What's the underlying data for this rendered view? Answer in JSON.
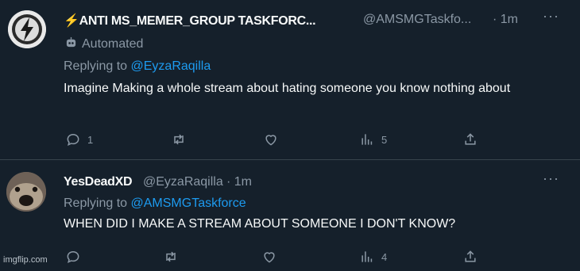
{
  "tweet1": {
    "display_name": "⚡ANTI MS_MEMER_GROUP TASKFORC...",
    "handle": "@AMSMGTaskfo...",
    "time": "· 1m",
    "automated_label": "Automated",
    "replying_to_prefix": "Replying to",
    "replying_to_handle": "@EyzaRaqilla",
    "text": "Imagine Making a whole stream about hating someone you know nothing about",
    "reply_count": "1",
    "retweet_count": "",
    "like_count": "",
    "views_count": "5"
  },
  "tweet2": {
    "display_name": "YesDeadXD",
    "handle": "@EyzaRaqilla",
    "time": "· 1m",
    "replying_to_prefix": "Replying to",
    "replying_to_handle": "@AMSMGTaskforce",
    "text": "WHEN DID I MAKE A STREAM ABOUT SOMEONE I DON'T KNOW?",
    "reply_count": "",
    "retweet_count": "",
    "like_count": "",
    "views_count": "4"
  },
  "more_label": "···",
  "watermark": "imgflip.com",
  "colors": {
    "background": "#15202b",
    "text": "#f7f9f9",
    "secondary": "#8b98a5",
    "link": "#1d9bf0",
    "divider": "#38444d"
  },
  "icons": [
    "lightning-logo-avatar",
    "robot-icon",
    "more-icon",
    "reply-icon",
    "retweet-icon",
    "like-icon",
    "views-icon",
    "share-icon",
    "toad-avatar"
  ]
}
